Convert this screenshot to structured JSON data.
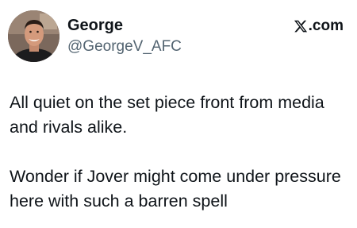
{
  "author": {
    "display_name": "George",
    "handle": "@GeorgeV_AFC"
  },
  "source": {
    "icon": "x-logo-icon",
    "label": ".com"
  },
  "tweet": {
    "paragraphs": [
      "All quiet on the set piece front from media and rivals alike.",
      "Wonder if Jover might come under pressure here with such a barren spell"
    ]
  }
}
